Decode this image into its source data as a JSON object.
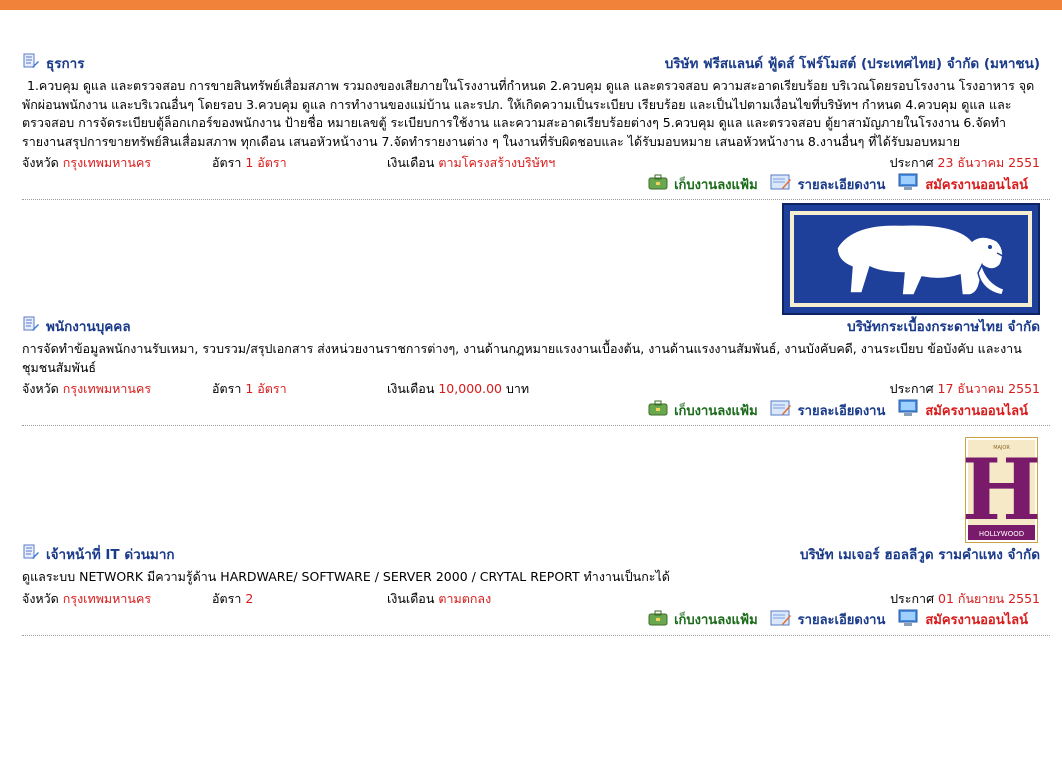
{
  "colors": {
    "accent_bar": "#f0823a",
    "link_blue": "#1a3a8a",
    "value_red": "#d81b1b",
    "save_green": "#1a6a1a"
  },
  "labels": {
    "province": "จังหวัด",
    "rate": "อัตรา",
    "salary": "เงินเดือน",
    "announced": "ประกาศ",
    "save": "เก็บงานลงแฟ้ม",
    "details": "รายละเอียดงาน",
    "apply": "สมัครงานออนไลน์"
  },
  "jobs": [
    {
      "title": "ธุรการ",
      "company": "บริษัท ฟรีสแลนด์ ฟู้ดส์ โฟร์โมสต์ (ประเทศไทย) จำกัด (มหาชน)",
      "description": "1.ควบคุม ดูแล และตรวจสอบ การขายสินทรัพย์เสื่อมสภาพ รวมถงของเสียภายในโรงงานที่กำหนด 2.ควบคุม ดูแล และตรวจสอบ ความสะอาดเรียบร้อย บริเวณโดยรอบโรงงาน โรงอาหาร จุดพักผ่อนพนักงาน และบริเวณอื่นๆ โดยรอบ 3.ควบคุม ดูแล การทำงานของแม่บ้าน และรปภ. ให้เกิดความเป็นระเบียบ เรียบร้อย และเป็นไปตามเงื่อนไขที่บริษัทฯ กำหนด 4.ควบคุม ดูแล และตรวจสอบ การจัดระเบียบตู้ล็อกเกอร์ของพนักงาน ป้ายชื่อ หมายเลขตู้ ระเบียบการใช้งาน และความสะอาดเรียบร้อยต่างๆ 5.ควบคุม ดูแล และตรวจสอบ ตู้ยาสามัญภายในโรงงาน 6.จัดทำรายงานสรุปการขายทรัพย์สินเสื่อมสภาพ ทุกเดือน เสนอหัวหน้างาน 7.จัดทำรายงานต่าง ๆ ในงานที่รับผิดชอบและ ได้รับมอบหมาย เสนอหัวหน้างาน 8.งานอื่นๆ ที่ได้รับมอบหมาย",
      "province": "กรุงเทพมหานคร",
      "rate": "1 อัตรา",
      "salary": "ตามโครงสร้างบริษัทฯ",
      "salary_unit": "",
      "date": "23 ธันวาคม 2551"
    },
    {
      "title": "พนักงานบุคคล",
      "company": "บริษัทกระเบื้องกระดาษไทย จำกัด",
      "description": "การจัดทำข้อมูลพนักงานรับเหมา, รวบรวม/สรุปเอกสาร ส่งหน่วยงานราชการต่างๆ, งานด้านกฎหมายแรงงานเบื้องต้น, งานด้านแรงงานสัมพันธ์, งานบังคับคดี, งานระเบียบ ข้อบังคับ และงานชุมชนสัมพันธ์",
      "province": "กรุงเทพมหานคร",
      "rate": "1 อัตรา",
      "salary": "10,000.00",
      "salary_unit": "บาท",
      "date": "17 ธันวาคม 2551",
      "logo": "elephant-logo"
    },
    {
      "title": "เจ้าหน้าที่ IT ด่วนมาก",
      "company": "บริษัท เมเจอร์ ฮอลลีวูด รามคำแหง จำกัด",
      "description": "ดูแลระบบ NETWORK มีความรู้ด้าน HARDWARE/ SOFTWARE / SERVER 2000 / CRYTAL REPORT ทำงานเป็นกะได้",
      "province": "กรุงเทพมหานคร",
      "rate": "2",
      "salary": "ตามตกลง",
      "salary_unit": "",
      "date": "01 กันยายน 2551",
      "logo": "hollywood-logo",
      "logo_text": {
        "top": "MAJOR",
        "letter": "H",
        "bottom": "HOLLYWOOD"
      }
    }
  ]
}
